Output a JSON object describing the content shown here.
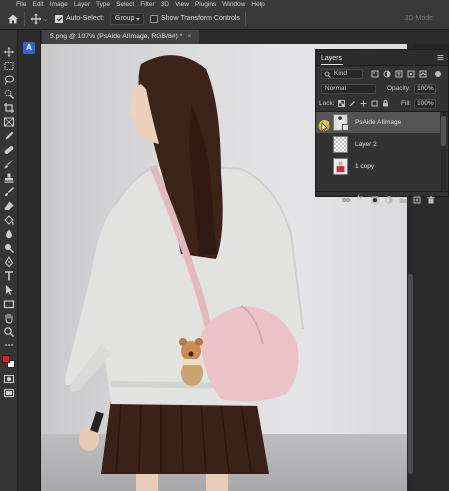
{
  "menu": [
    "File",
    "Edit",
    "Image",
    "Layer",
    "Type",
    "Select",
    "Filter",
    "3D",
    "View",
    "Plugins",
    "Window",
    "Help"
  ],
  "options": {
    "auto_select_label": "Auto-Select:",
    "auto_select_checked": true,
    "auto_select_target": "Group",
    "transform_label": "Show Transform Controls",
    "transform_checked": false,
    "mode_3d": "3D Mode:"
  },
  "document_tab": {
    "title": "5.png @ 107% (PsAide AIImage, RGB/8#) *",
    "close": "×"
  },
  "toolbar_icons": [
    "move-icon",
    "marquee-icon",
    "lasso-icon",
    "quick-select-icon",
    "crop-icon",
    "frame-icon",
    "eyedropper-icon",
    "healing-brush-icon",
    "brush-icon",
    "clone-stamp-icon",
    "history-brush-icon",
    "eraser-icon",
    "gradient-icon",
    "blur-icon",
    "dodge-icon",
    "pen-icon",
    "type-icon",
    "path-select-icon",
    "rectangle-icon",
    "hand-icon",
    "zoom-icon",
    "more-tools-icon"
  ],
  "colors": {
    "foreground": "#e01e1e",
    "background": "#ffffff",
    "accent": "#3466c7"
  },
  "plugin_badge": "A",
  "layers_panel": {
    "title": "Layers",
    "filter_kind": "Kind",
    "blend_mode": "Normal",
    "opacity_label": "Opacity:",
    "opacity_value": "100%",
    "lock_label": "Lock:",
    "fill_label": "Fill:",
    "fill_value": "100%",
    "layers": [
      {
        "name": "PsAide AIImage",
        "selected": true,
        "visible": true
      },
      {
        "name": "Layer 2",
        "selected": false,
        "visible": false
      },
      {
        "name": "1 copy",
        "selected": false,
        "visible": false
      }
    ],
    "footer_icons": [
      "link-layers-icon",
      "fx-icon",
      "mask-icon",
      "adjustment-icon",
      "group-icon",
      "new-layer-icon",
      "trash-icon"
    ],
    "fx_label": "fx"
  }
}
